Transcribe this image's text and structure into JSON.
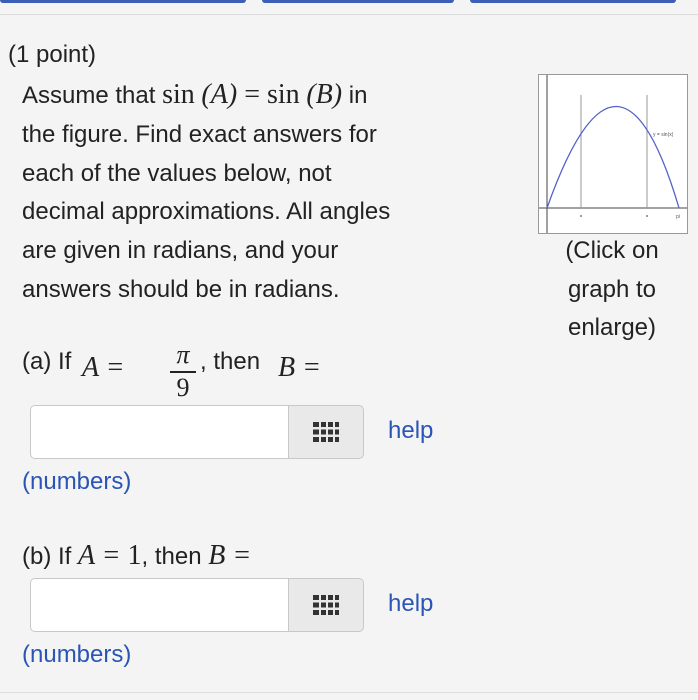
{
  "header": {
    "points": "(1 point)"
  },
  "problem": {
    "line1_pre": "Assume that ",
    "sinA": "sin",
    "sinA_arg": "(A)",
    "equals": " = ",
    "sinB": "sin",
    "sinB_arg": "(B)",
    "line1_post": " in",
    "line2": "the figure. Find exact answers for",
    "line3": "each of the values below, not",
    "line4": "decimal approximations. All angles",
    "line5": "are given in radians, and your",
    "line6": "answers should be in radians."
  },
  "graph": {
    "caption_line1": "(Click on",
    "caption_line2": "graph to",
    "caption_line3": "enlarge)",
    "curve_label": "y = sin(x)",
    "axis_end_label": "pi"
  },
  "part_a": {
    "label": "(a) If",
    "lhs": "A =",
    "numerator": "π",
    "denominator": "9",
    "tail": ", then",
    "rhs": "B ="
  },
  "part_b": {
    "label": "(b) If ",
    "lhs": "A = ",
    "value": "1",
    "tail": ", then ",
    "rhs": "B ="
  },
  "answers": {
    "a": {
      "value": "",
      "help": "help",
      "hint": "(numbers)"
    },
    "b": {
      "value": "",
      "help": "help",
      "hint": "(numbers)"
    }
  },
  "colors": {
    "link": "#2b55b5",
    "curve": "#5561c9",
    "tab": "#3a5fb5"
  }
}
